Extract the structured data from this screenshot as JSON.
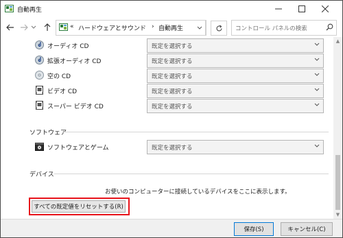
{
  "window": {
    "title": "自動再生"
  },
  "address": {
    "overflow": "«",
    "crumb1": "ハードウェアとサウンド",
    "separator": "›",
    "crumb2": "自動再生"
  },
  "search": {
    "placeholder": "コントロール パネルの検索"
  },
  "media_rows": [
    {
      "label": "オーディオ CD",
      "value": "既定を選択する",
      "icon": "audio-cd-icon"
    },
    {
      "label": "拡張オーディオ CD",
      "value": "既定を選択する",
      "icon": "enhanced-audio-cd-icon"
    },
    {
      "label": "空の CD",
      "value": "既定を選択する",
      "icon": "blank-cd-icon"
    },
    {
      "label": "ビデオ CD",
      "value": "既定を選択する",
      "icon": "video-cd-icon"
    },
    {
      "label": "スーパー ビデオ CD",
      "value": "既定を選択する",
      "icon": "super-video-cd-icon"
    }
  ],
  "software": {
    "heading": "ソフトウェア",
    "label": "ソフトウェアとゲーム",
    "value": "既定を選択する"
  },
  "devices": {
    "heading": "デバイス",
    "text": "お使いのコンピューターに接続しているデバイスをここに表示します。"
  },
  "reset_button": "すべての既定値をリセットする(R)",
  "footer": {
    "save": "保存(S)",
    "cancel": "キャンセル(C)"
  },
  "colors": {
    "highlight": "#e8121a",
    "accent": "#0078d7"
  }
}
